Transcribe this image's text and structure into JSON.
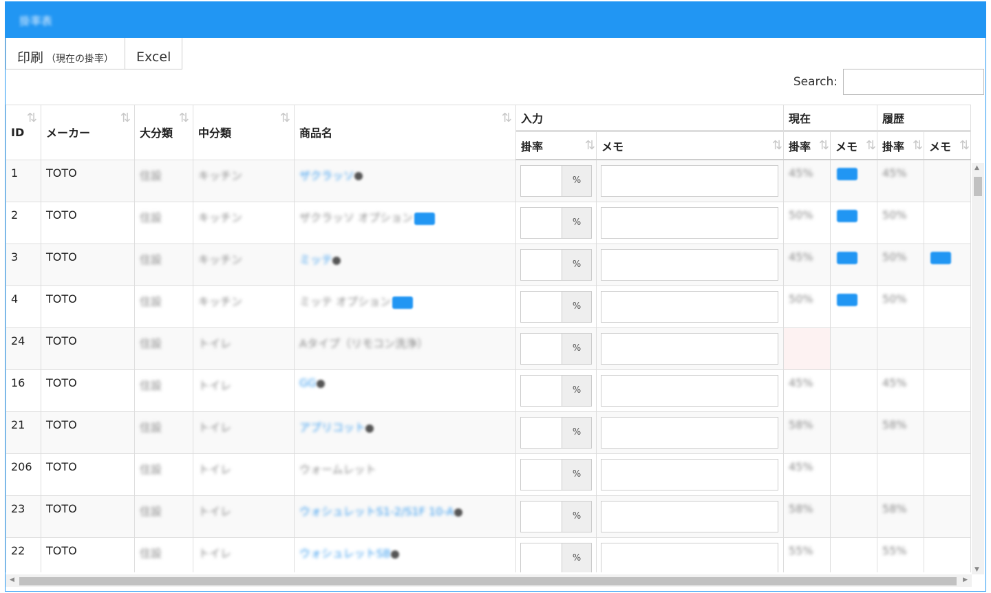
{
  "title": "掛率表",
  "buttons": {
    "print_label": "印刷",
    "print_note": "（現在の掛率）",
    "excel_label": "Excel"
  },
  "search": {
    "label": "Search:",
    "value": ""
  },
  "columns": {
    "id": "ID",
    "maker": "メーカー",
    "major": "大分類",
    "middle": "中分類",
    "product": "商品名",
    "input_group": "入力",
    "current_group": "現在",
    "history_group": "履歴",
    "rate": "掛率",
    "memo": "メモ"
  },
  "percent_symbol": "%",
  "rows": [
    {
      "id": "1",
      "maker": "TOTO",
      "major": "住設",
      "middle": "キッチン",
      "product": "ザクラッソ",
      "link": true,
      "dark": true,
      "pill": false,
      "cur_rate": "45%",
      "cur_memo": true,
      "hist_rate": "45%",
      "hist_memo": false,
      "red": false
    },
    {
      "id": "2",
      "maker": "TOTO",
      "major": "住設",
      "middle": "キッチン",
      "product": "ザクラッソ オプション",
      "link": false,
      "dark": false,
      "pill": true,
      "cur_rate": "50%",
      "cur_memo": true,
      "hist_rate": "50%",
      "hist_memo": false,
      "red": false
    },
    {
      "id": "3",
      "maker": "TOTO",
      "major": "住設",
      "middle": "キッチン",
      "product": "ミッテ",
      "link": true,
      "dark": true,
      "pill": false,
      "cur_rate": "45%",
      "cur_memo": true,
      "hist_rate": "50%",
      "hist_memo": true,
      "red": false
    },
    {
      "id": "4",
      "maker": "TOTO",
      "major": "住設",
      "middle": "キッチン",
      "product": "ミッテ オプション",
      "link": false,
      "dark": false,
      "pill": true,
      "cur_rate": "50%",
      "cur_memo": true,
      "hist_rate": "50%",
      "hist_memo": false,
      "red": false
    },
    {
      "id": "24",
      "maker": "TOTO",
      "major": "住設",
      "middle": "トイレ",
      "product": "Aタイプ（リモコン洗浄）",
      "link": false,
      "dark": false,
      "pill": false,
      "cur_rate": "",
      "cur_memo": false,
      "hist_rate": "",
      "hist_memo": false,
      "red": true
    },
    {
      "id": "16",
      "maker": "TOTO",
      "major": "住設",
      "middle": "トイレ",
      "product": "GG",
      "link": true,
      "dark": true,
      "pill": false,
      "cur_rate": "45%",
      "cur_memo": false,
      "hist_rate": "45%",
      "hist_memo": false,
      "red": false
    },
    {
      "id": "21",
      "maker": "TOTO",
      "major": "住設",
      "middle": "トイレ",
      "product": "アプリコット",
      "link": true,
      "dark": true,
      "pill": false,
      "cur_rate": "58%",
      "cur_memo": false,
      "hist_rate": "58%",
      "hist_memo": false,
      "red": false
    },
    {
      "id": "206",
      "maker": "TOTO",
      "major": "住設",
      "middle": "トイレ",
      "product": "ウォームレット",
      "link": false,
      "dark": false,
      "pill": false,
      "cur_rate": "45%",
      "cur_memo": false,
      "hist_rate": "",
      "hist_memo": false,
      "red": false
    },
    {
      "id": "23",
      "maker": "TOTO",
      "major": "住設",
      "middle": "トイレ",
      "product": "ウォシュレットS1-2/S1F 10-A",
      "link": true,
      "dark": true,
      "pill": false,
      "cur_rate": "58%",
      "cur_memo": false,
      "hist_rate": "58%",
      "hist_memo": false,
      "red": false
    },
    {
      "id": "22",
      "maker": "TOTO",
      "major": "住設",
      "middle": "トイレ",
      "product": "ウォシュレットSB",
      "link": true,
      "dark": true,
      "pill": false,
      "cur_rate": "55%",
      "cur_memo": false,
      "hist_rate": "55%",
      "hist_memo": false,
      "red": false
    }
  ]
}
